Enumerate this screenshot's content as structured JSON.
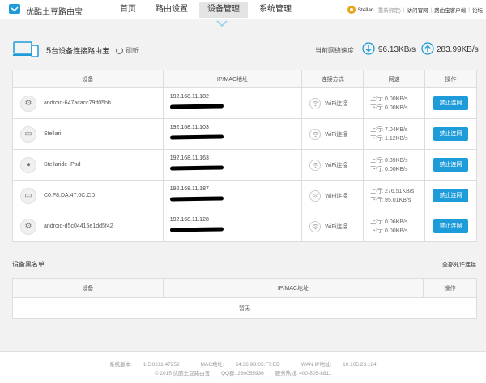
{
  "header": {
    "brand": "优酷土豆路由宝",
    "nav": [
      "首页",
      "路由设置",
      "设备管理",
      "系统管理"
    ],
    "active_nav": "设备管理",
    "user": {
      "name": "Stellari",
      "rebind": "(重新绑定)",
      "links": [
        "访问官网",
        "路由宝客户端",
        "论坛"
      ]
    }
  },
  "status": {
    "device_count": "5",
    "device_count_label": "台设备连接路由宝",
    "refresh": "刷新",
    "speed_label": "当前网络速度",
    "down_speed": "96.13",
    "down_unit": "KB/s",
    "up_speed": "283.99",
    "up_unit": "KB/s"
  },
  "devices_table": {
    "headers": [
      "设备",
      "IP/MAC地址",
      "连接方式",
      "网速",
      "操作"
    ],
    "up_label": "上行:",
    "down_label": "下行:",
    "rows": [
      {
        "name": "android-647acacc79ff05bb",
        "os": "android-icon",
        "ip": "192.168.11.182",
        "conn": "WiFi连接",
        "up": "0.00KB/s",
        "down": "0.00KB/s",
        "action": "禁止连网"
      },
      {
        "name": "Stellari",
        "os": "laptop-icon",
        "ip": "192.168.11.103",
        "conn": "WiFi连接",
        "up": "7.04KB/s",
        "down": "1.12KB/s",
        "action": "禁止连网"
      },
      {
        "name": "Stellaride-iPad",
        "os": "apple-icon",
        "ip": "192.168.11.163",
        "conn": "WiFi连接",
        "up": "0.39KB/s",
        "down": "0.00KB/s",
        "action": "禁止连网"
      },
      {
        "name": "C0:F8:DA:47:0C:CD",
        "os": "laptop-icon",
        "ip": "192.168.11.187",
        "conn": "WiFi连接",
        "up": "276.51KB/s",
        "down": "95.01KB/s",
        "action": "禁止连网"
      },
      {
        "name": "android-d5c04415e1dd5f42",
        "os": "android-icon",
        "ip": "192.168.11.128",
        "conn": "WiFi连接",
        "up": "0.06KB/s",
        "down": "0.00KB/s",
        "action": "禁止连网"
      }
    ]
  },
  "blacklist": {
    "title": "设备黑名单",
    "allow_all": "全部允许连接",
    "headers": [
      "设备",
      "IP/MAC地址",
      "操作"
    ],
    "empty": "暂无"
  },
  "footer": {
    "version_label": "系统版本:",
    "version": "1.5.0211.47252",
    "mac_label": "MAC地址:",
    "mac": "54:36:9B:05:F7:ED",
    "wan_label": "WAN IP地址:",
    "wan": "10.105.23.184",
    "copyright": "© 2015 优酷土豆路由宝",
    "qq": "QQ群: 260055936",
    "hotline": "服务热线: 400-805-8811"
  },
  "colors": {
    "accent": "#1e9bd9",
    "avatar": "#e8a317"
  }
}
